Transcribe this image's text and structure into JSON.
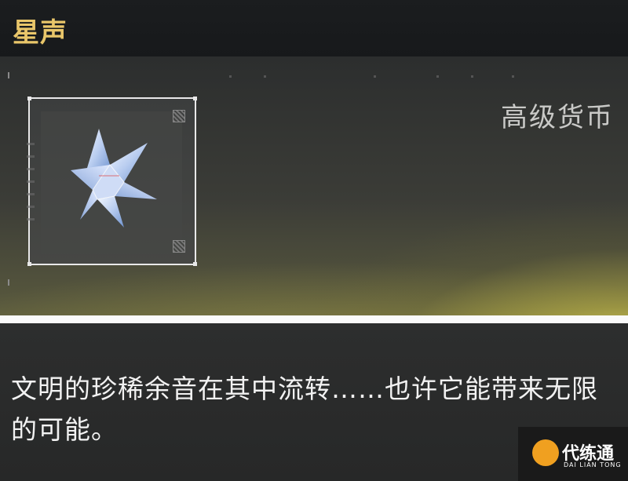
{
  "header": {
    "item_name": "星声"
  },
  "panel": {
    "category": "高级货币",
    "item_icon": "star-crystal-icon"
  },
  "description": "文明的珍稀余音在其中流转……也许它能带来无限的可能。",
  "watermark": {
    "brand": "代练通",
    "sub": "DAI LIAN TONG"
  },
  "colors": {
    "item_name": "#e9c66a",
    "accent_glow": "#eee45f",
    "divider": "#fafafa"
  }
}
